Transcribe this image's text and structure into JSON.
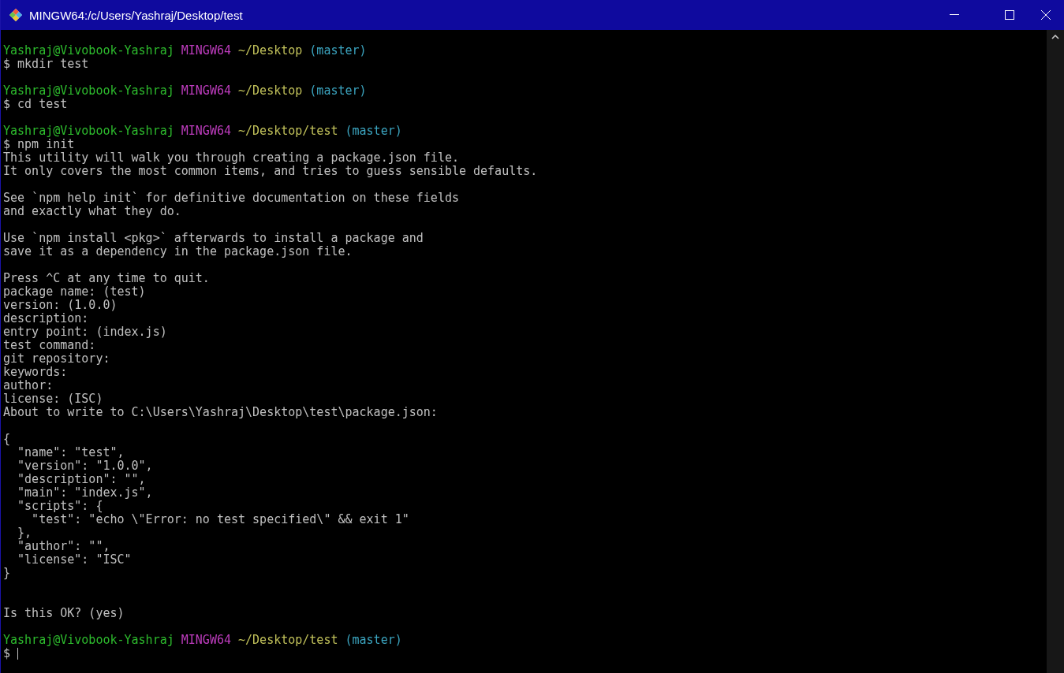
{
  "window": {
    "title": "MINGW64:/c/Users/Yashraj/Desktop/test"
  },
  "terminal": {
    "lines": [
      {
        "kind": "prompt",
        "user": "Yashraj@Vivobook-Yashraj",
        "shell": "MINGW64",
        "path": "~/Desktop",
        "branch": "(master)"
      },
      {
        "kind": "text",
        "text": "$ mkdir test"
      },
      {
        "kind": "blank"
      },
      {
        "kind": "prompt",
        "user": "Yashraj@Vivobook-Yashraj",
        "shell": "MINGW64",
        "path": "~/Desktop",
        "branch": "(master)"
      },
      {
        "kind": "text",
        "text": "$ cd test"
      },
      {
        "kind": "blank"
      },
      {
        "kind": "prompt",
        "user": "Yashraj@Vivobook-Yashraj",
        "shell": "MINGW64",
        "path": "~/Desktop/test",
        "branch": "(master)"
      },
      {
        "kind": "text",
        "text": "$ npm init"
      },
      {
        "kind": "text",
        "text": "This utility will walk you through creating a package.json file."
      },
      {
        "kind": "text",
        "text": "It only covers the most common items, and tries to guess sensible defaults."
      },
      {
        "kind": "blank"
      },
      {
        "kind": "text",
        "text": "See `npm help init` for definitive documentation on these fields"
      },
      {
        "kind": "text",
        "text": "and exactly what they do."
      },
      {
        "kind": "blank"
      },
      {
        "kind": "text",
        "text": "Use `npm install <pkg>` afterwards to install a package and"
      },
      {
        "kind": "text",
        "text": "save it as a dependency in the package.json file."
      },
      {
        "kind": "blank"
      },
      {
        "kind": "text",
        "text": "Press ^C at any time to quit."
      },
      {
        "kind": "text",
        "text": "package name: (test)"
      },
      {
        "kind": "text",
        "text": "version: (1.0.0)"
      },
      {
        "kind": "text",
        "text": "description:"
      },
      {
        "kind": "text",
        "text": "entry point: (index.js)"
      },
      {
        "kind": "text",
        "text": "test command:"
      },
      {
        "kind": "text",
        "text": "git repository:"
      },
      {
        "kind": "text",
        "text": "keywords:"
      },
      {
        "kind": "text",
        "text": "author:"
      },
      {
        "kind": "text",
        "text": "license: (ISC)"
      },
      {
        "kind": "text",
        "text": "About to write to C:\\Users\\Yashraj\\Desktop\\test\\package.json:"
      },
      {
        "kind": "blank"
      },
      {
        "kind": "text",
        "text": "{"
      },
      {
        "kind": "text",
        "text": "  \"name\": \"test\","
      },
      {
        "kind": "text",
        "text": "  \"version\": \"1.0.0\","
      },
      {
        "kind": "text",
        "text": "  \"description\": \"\","
      },
      {
        "kind": "text",
        "text": "  \"main\": \"index.js\","
      },
      {
        "kind": "text",
        "text": "  \"scripts\": {"
      },
      {
        "kind": "text",
        "text": "    \"test\": \"echo \\\"Error: no test specified\\\" && exit 1\""
      },
      {
        "kind": "text",
        "text": "  },"
      },
      {
        "kind": "text",
        "text": "  \"author\": \"\","
      },
      {
        "kind": "text",
        "text": "  \"license\": \"ISC\""
      },
      {
        "kind": "text",
        "text": "}"
      },
      {
        "kind": "blank"
      },
      {
        "kind": "blank"
      },
      {
        "kind": "text",
        "text": "Is this OK? (yes)"
      },
      {
        "kind": "blank"
      },
      {
        "kind": "prompt",
        "user": "Yashraj@Vivobook-Yashraj",
        "shell": "MINGW64",
        "path": "~/Desktop/test",
        "branch": "(master)"
      },
      {
        "kind": "input",
        "text": "$"
      }
    ]
  }
}
